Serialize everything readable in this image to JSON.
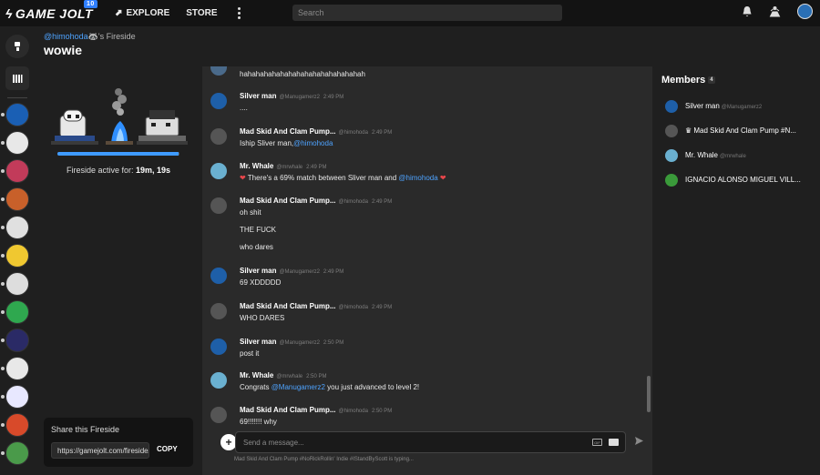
{
  "header": {
    "logo_text": "GAME JOLT",
    "logo_badge": "10",
    "nav": [
      "EXPLORE",
      "STORE"
    ],
    "search_placeholder": "Search"
  },
  "fireside": {
    "owner": "@himohoda",
    "owner_suffix": "'s Fireside",
    "title": "wowie",
    "active_label": "Fireside active for:",
    "active_time": "19m, 19s",
    "progress": 0.99,
    "share_label": "Share this Fireside",
    "share_url": "https://gamejolt.com/fireside/",
    "copy_label": "COPY"
  },
  "chat": {
    "messages": [
      {
        "author": "",
        "handle": "",
        "time": "",
        "lines": [
          "hahahahahahahahahahahahahahahah"
        ],
        "avatar": "#4a6a8a"
      },
      {
        "author": "Silver man",
        "handle": "@Manugamerz2",
        "time": "2:49 PM",
        "lines": [
          "...."
        ],
        "avatar": "#1e5fa8"
      },
      {
        "author": "Mad Skid And Clam Pump...",
        "handle": "@himohoda",
        "time": "2:49 PM",
        "lines": [
          "Iship Sliver man,"
        ],
        "mention": "@himohoda",
        "avatar": "#555"
      },
      {
        "author": "Mr. Whale",
        "handle": "@mrwhale",
        "time": "2:49 PM",
        "lines": [
          "There's a 69% match between Sliver man and "
        ],
        "mention": "@himohoda",
        "avatar": "#6ab0d0"
      },
      {
        "author": "Mad Skid And Clam Pump...",
        "handle": "@himohoda",
        "time": "2:49 PM",
        "lines": [
          "oh shit",
          "THE FUCK",
          "who dares"
        ],
        "avatar": "#555"
      },
      {
        "author": "Silver man",
        "handle": "@Manugamerz2",
        "time": "2:49 PM",
        "lines": [
          "69 XDDDDD"
        ],
        "avatar": "#1e5fa8"
      },
      {
        "author": "Mad Skid And Clam Pump...",
        "handle": "@himohoda",
        "time": "2:49 PM",
        "lines": [
          "WHO DARES"
        ],
        "avatar": "#555"
      },
      {
        "author": "Silver man",
        "handle": "@Manugamerz2",
        "time": "2:50 PM",
        "lines": [
          "post it"
        ],
        "avatar": "#1e5fa8"
      },
      {
        "author": "Mr. Whale",
        "handle": "@mrwhale",
        "time": "2:50 PM",
        "lines": [
          "Congrats ",
          " you just advanced to level 2!"
        ],
        "mention": "@Manugamerz2",
        "avatar": "#6ab0d0"
      },
      {
        "author": "Mad Skid And Clam Pump...",
        "handle": "@himohoda",
        "time": "2:50 PM",
        "lines": [
          "69!!!!!!! why"
        ],
        "avatar": "#555"
      }
    ],
    "composer_placeholder": "Send a message...",
    "typing": "Mad Skid And Clam Pump #NoRickRollin' Indie #IStandByScott is typing..."
  },
  "members": {
    "title": "Members",
    "count": "4",
    "list": [
      {
        "name": "Silver man",
        "handle": "@Manugamerz2",
        "avatar": "#1e5fa8"
      },
      {
        "name": "♛ Mad Skid And Clam Pump #N...",
        "handle": "",
        "avatar": "#555"
      },
      {
        "name": "Mr. Whale",
        "handle": "@mrwhale",
        "avatar": "#6ab0d0"
      },
      {
        "name": "IGNACIO ALONSO MIGUEL VILL...",
        "handle": "",
        "avatar": "#3a9a3a"
      }
    ]
  },
  "rail": {
    "avatars": [
      "#1a5fb4",
      "#e8e8e8",
      "#c23b5a",
      "#c8602a",
      "#e0e0e0",
      "#f0c830",
      "#ddd",
      "#2fa84f",
      "#2a2a66",
      "#e8e8e8",
      "#e8e8ff",
      "#d84a2a",
      "#4a9a4a"
    ]
  }
}
